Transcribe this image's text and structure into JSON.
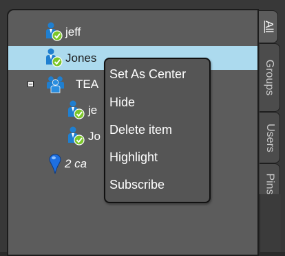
{
  "tree": {
    "items": [
      {
        "label": "jeff",
        "icon": "user-online-icon",
        "italic": false,
        "selected": false
      },
      {
        "label": "Jones",
        "icon": "user-online-icon",
        "italic": false,
        "selected": true
      },
      {
        "label": "TEA",
        "icon": "group-icon",
        "italic": false,
        "selected": false
      },
      {
        "label": "je",
        "icon": "user-online-icon",
        "italic": false,
        "selected": false
      },
      {
        "label": "Jo",
        "icon": "user-online-icon",
        "italic": false,
        "selected": false
      },
      {
        "label": "2 ca",
        "icon": "map-pin-icon",
        "italic": true,
        "selected": false
      }
    ]
  },
  "tabs": [
    {
      "label": "All",
      "active": true
    },
    {
      "label": "Groups",
      "active": false
    },
    {
      "label": "Users",
      "active": false
    },
    {
      "label": "Pins",
      "active": false
    }
  ],
  "context_menu": {
    "items": [
      "Set As Center",
      "Hide",
      "Delete item",
      "Highlight",
      "Subscribe"
    ]
  },
  "colors": {
    "selection": "#acdaee",
    "panel": "#5c5c5c",
    "menu": "#555555",
    "status_check": "#7cc62a",
    "user_icon": "#1f7fd0",
    "pin": "#1e6fe0"
  }
}
